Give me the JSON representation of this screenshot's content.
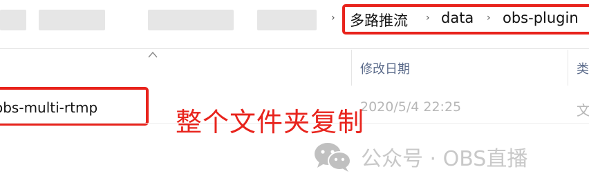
{
  "breadcrumb": {
    "items": [
      "多路推流",
      "data",
      "obs-plugin"
    ],
    "separator": "›"
  },
  "columns": {
    "date_modified": "修改日期",
    "type": "类"
  },
  "file": {
    "name": "obs-multi-rtmp",
    "date_modified": "2020/5/4 22:25",
    "type": "文"
  },
  "annotation": {
    "text": "整个文件夹复制",
    "color": "#e8231c"
  },
  "watermark": {
    "icon": "wechat-icon",
    "text": "公众号 · OBS直播"
  },
  "colors": {
    "highlight_red": "#e8231c",
    "header_text": "#5a6a8a",
    "muted_text": "#b7b7b7"
  }
}
